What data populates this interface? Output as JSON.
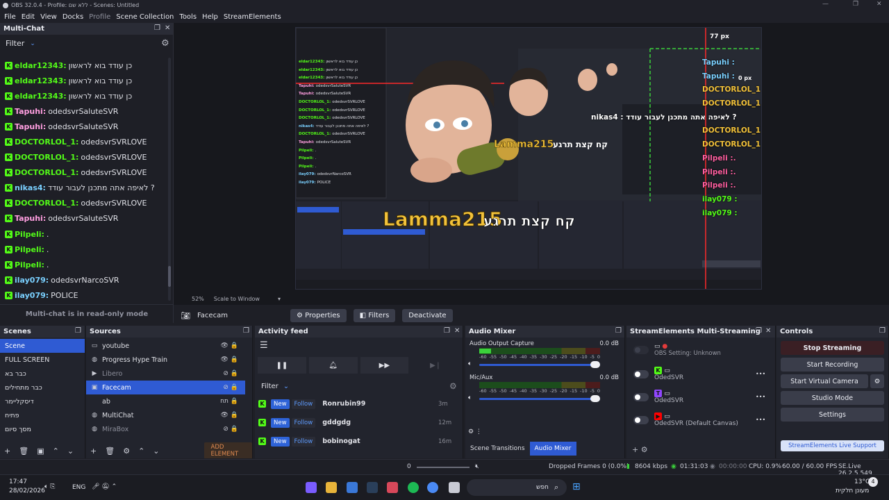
{
  "window": {
    "title": "OBS 32.0.4 - Profile: ללא שם - Scenes: Untitled"
  },
  "menu": [
    "File",
    "Edit",
    "View",
    "Docks",
    "Profile",
    "Scene Collection",
    "Tools",
    "Help",
    "StreamElements"
  ],
  "chat": {
    "title": "Multi-Chat",
    "filter": "Filter",
    "footer": "Multi-chat is in read-only mode",
    "messages": [
      {
        "user": "eldar12343:",
        "text": "כן עודד בוא לראשון",
        "color": "#53fc18"
      },
      {
        "user": "eldar12343:",
        "text": "כן עודד בוא לראשון",
        "color": "#53fc18"
      },
      {
        "user": "eldar12343:",
        "text": "כן עודד בוא לראשון",
        "color": "#53fc18"
      },
      {
        "user": "Tapuhi:",
        "text": "odedsvrSaluteSVR",
        "color": "#ff9ee0"
      },
      {
        "user": "Tapuhi:",
        "text": "odedsvrSaluteSVR",
        "color": "#ff9ee0"
      },
      {
        "user": "DOCTORLOL_1:",
        "text": "odedsvrSVRLOVE",
        "color": "#53fc18"
      },
      {
        "user": "DOCTORLOL_1:",
        "text": "odedsvrSVRLOVE",
        "color": "#53fc18"
      },
      {
        "user": "DOCTORLOL_1:",
        "text": "odedsvrSVRLOVE",
        "color": "#53fc18"
      },
      {
        "user": "nikas4:",
        "text": "לאיפה אתה מתכנן לעבור עודד ?",
        "color": "#7ad0ff"
      },
      {
        "user": "DOCTORLOL_1:",
        "text": "odedsvrSVRLOVE",
        "color": "#53fc18"
      },
      {
        "user": "Tapuhi:",
        "text": "odedsvrSaluteSVR",
        "color": "#ff9ee0"
      },
      {
        "user": "Pilpeli:",
        "text": ".",
        "color": "#53fc18"
      },
      {
        "user": "Pilpeli:",
        "text": ".",
        "color": "#53fc18"
      },
      {
        "user": "Pilpeli:",
        "text": ".",
        "color": "#53fc18"
      },
      {
        "user": "ilay079:",
        "text": "odedsvrNarcoSVR",
        "color": "#7ad0ff"
      },
      {
        "user": "ilay079:",
        "text": "POLICE",
        "color": "#7ad0ff"
      }
    ]
  },
  "preview": {
    "zoom": "52%",
    "scale_mode": "Scale to Window",
    "overlay_name": "Lamma215",
    "overlay_text": "קח קצת תרגע",
    "measure_top": "77 px",
    "measure_right": "0 px",
    "mirror_names": [
      "Tapuhi :",
      "Tapuhi :",
      "DOCTORLOL_1 :",
      "DOCTORLOL_1 :",
      "nikas4 : לאיפה אתה מתכנן לעבור עודד ?",
      "DOCTORLOL_1 :",
      "DOCTORLOL_1 :",
      "Pilpeli :.",
      "Pilpeli :.",
      "Pilpeli :.",
      "ilay079 :",
      "ilay079 :"
    ]
  },
  "source_bar": {
    "current": "Facecam",
    "properties": "Properties",
    "filters": "Filters",
    "deactivate": "Deactivate"
  },
  "scenes": {
    "title": "Scenes",
    "items": [
      "Scene",
      "FULL SCREEN",
      "כבר בא",
      "כבר מתחילים",
      "דיסקליימר",
      "פתיח",
      "מסך סיום"
    ],
    "selected": 0
  },
  "sources": {
    "title": "Sources",
    "add_element": "ADD ELEMENT",
    "items": [
      {
        "name": "youtube",
        "icon": "window-icon",
        "right": "👁 🔒",
        "state": "normal"
      },
      {
        "name": "Progress Hype Train",
        "icon": "globe-icon",
        "right": "👁 🔒",
        "state": "normal"
      },
      {
        "name": "Libero",
        "icon": "play-icon",
        "right": "⊘ 🔒",
        "state": "dimmed"
      },
      {
        "name": "Facecam",
        "icon": "camera-icon",
        "right": "⊘ 🔒",
        "state": "selected"
      },
      {
        "name": "ab",
        "icon": "text-icon",
        "right": "תח 🔒",
        "state": "normal"
      },
      {
        "name": "MultiChat",
        "icon": "globe-icon",
        "right": "👁 🔒",
        "state": "normal"
      },
      {
        "name": "MiraBox",
        "icon": "globe-icon",
        "right": "⊘ 🔒",
        "state": "dimmed"
      }
    ]
  },
  "activity": {
    "title": "Activity feed",
    "filter": "Filter",
    "rows": [
      {
        "new": "New",
        "follow": "Follow",
        "name": "Ronrubin99",
        "time": "3m"
      },
      {
        "new": "New",
        "follow": "Follow",
        "name": "gddgdg",
        "time": "12m"
      },
      {
        "new": "New",
        "follow": "Follow",
        "name": "bobinogat",
        "time": "16m"
      }
    ]
  },
  "mixer": {
    "title": "Audio Mixer",
    "channels": [
      {
        "name": "Audio Output Capture",
        "db": "0.0 dB",
        "level": 0.1
      },
      {
        "name": "Mic/Aux",
        "db": "0.0 dB",
        "level": 0.0
      }
    ],
    "ticks": [
      "-60",
      "-55",
      "-50",
      "-45",
      "-40",
      "-35",
      "-30",
      "-25",
      "-20",
      "-15",
      "-10",
      "-5",
      "0"
    ],
    "tab_transitions": "Scene Transitions",
    "tab_mixer": "Audio Mixer"
  },
  "multistream": {
    "title": "StreamElements Multi-Streaming",
    "obs_setting": "OBS Setting: Unknown",
    "targets": [
      {
        "name": "OdedSVR",
        "platform": "kick",
        "color": "#53fc18"
      },
      {
        "name": "OdedSVR",
        "platform": "twitch",
        "color": "#9146ff"
      },
      {
        "name": "OdedSVR (Default Canvas)",
        "platform": "youtube",
        "color": "#ff0000"
      }
    ]
  },
  "controls": {
    "title": "Controls",
    "stop_streaming": "Stop Streaming",
    "start_recording": "Start Recording",
    "start_virtual_camera": "Start Virtual Camera",
    "studio_mode": "Studio Mode",
    "settings": "Settings",
    "live_support": "StreamElements Live Support"
  },
  "status": {
    "volume": "0",
    "dropped": "Dropped Frames 0 (0.0%)",
    "bitrate": "8604 kbps",
    "live_time": "01:31:03",
    "rec_time": "00:00:00",
    "cpu": "CPU: 0.9%",
    "fps": "60.00 / 60.00 FPS",
    "version": "SE.Live 26.2.5.549"
  },
  "taskbar": {
    "time": "17:47",
    "date": "28/02/2026",
    "lang": "ENG",
    "search": "חפש",
    "weather_temp": "13°C",
    "weather_text": "מעונן חלקית",
    "notif": "4"
  },
  "colors": {
    "accent": "#2f5bd3",
    "stop_button": "#3a1f24",
    "kick": "#53fc18"
  }
}
